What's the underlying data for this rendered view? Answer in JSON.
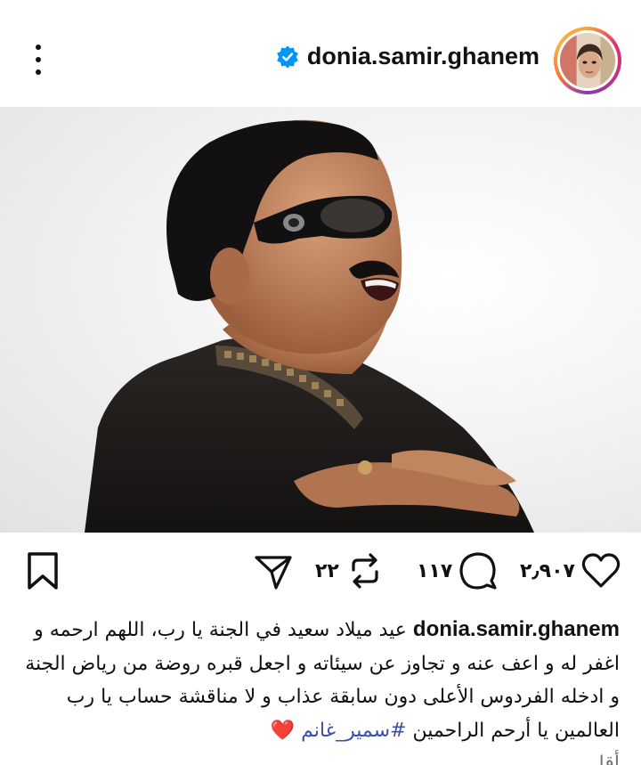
{
  "header": {
    "username": "donia.samir.ghanem",
    "verified_icon": "verified-badge-icon",
    "more_icon": "more-vertical-icon"
  },
  "post": {
    "image_alt": "post-photo"
  },
  "actions": {
    "likes": "٢٫٩٠٧",
    "comments": "١١٧",
    "reposts": "٢٢"
  },
  "caption": {
    "username": "donia.samir.ghanem",
    "text": "عيد ميلاد سعيد في الجنة يا رب، اللهم ارحمه و اغفر له و اعف عنه و تجاوز عن سيئاته و اجعل قبره روضة من رياض الجنة و ادخله الفردوس الأعلى دون سابقة عذاب و لا مناقشة حساب يا رب العالمين يا أرحم الراحمين",
    "hashtag": "#سمير_غانم",
    "emoji": "❤️",
    "more": "أقا"
  },
  "colors": {
    "verified": "#0095f6",
    "hashtag": "#3b4fa8",
    "text": "#111111"
  }
}
